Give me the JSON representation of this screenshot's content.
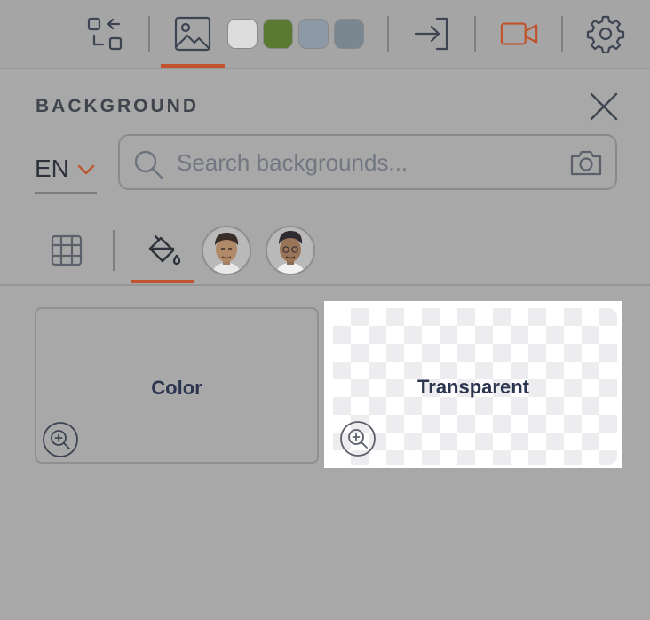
{
  "toolbar": {
    "icons": [
      "switch-layout-icon",
      "image-icon",
      "sign-in-icon",
      "video-camera-icon",
      "gear-icon"
    ],
    "swatches": [
      "#dcdcdc",
      "#5a7a32",
      "#8e99a6",
      "#7b8790"
    ],
    "accent": "#c0532d"
  },
  "panel": {
    "title": "BACKGROUND",
    "language": "EN",
    "search": {
      "placeholder": "Search backgrounds..."
    },
    "tabs": [
      "grid-icon",
      "paint-bucket-icon",
      "avatar-1",
      "avatar-2"
    ],
    "cards": [
      {
        "label": "Color"
      },
      {
        "label": "Transparent"
      }
    ]
  }
}
